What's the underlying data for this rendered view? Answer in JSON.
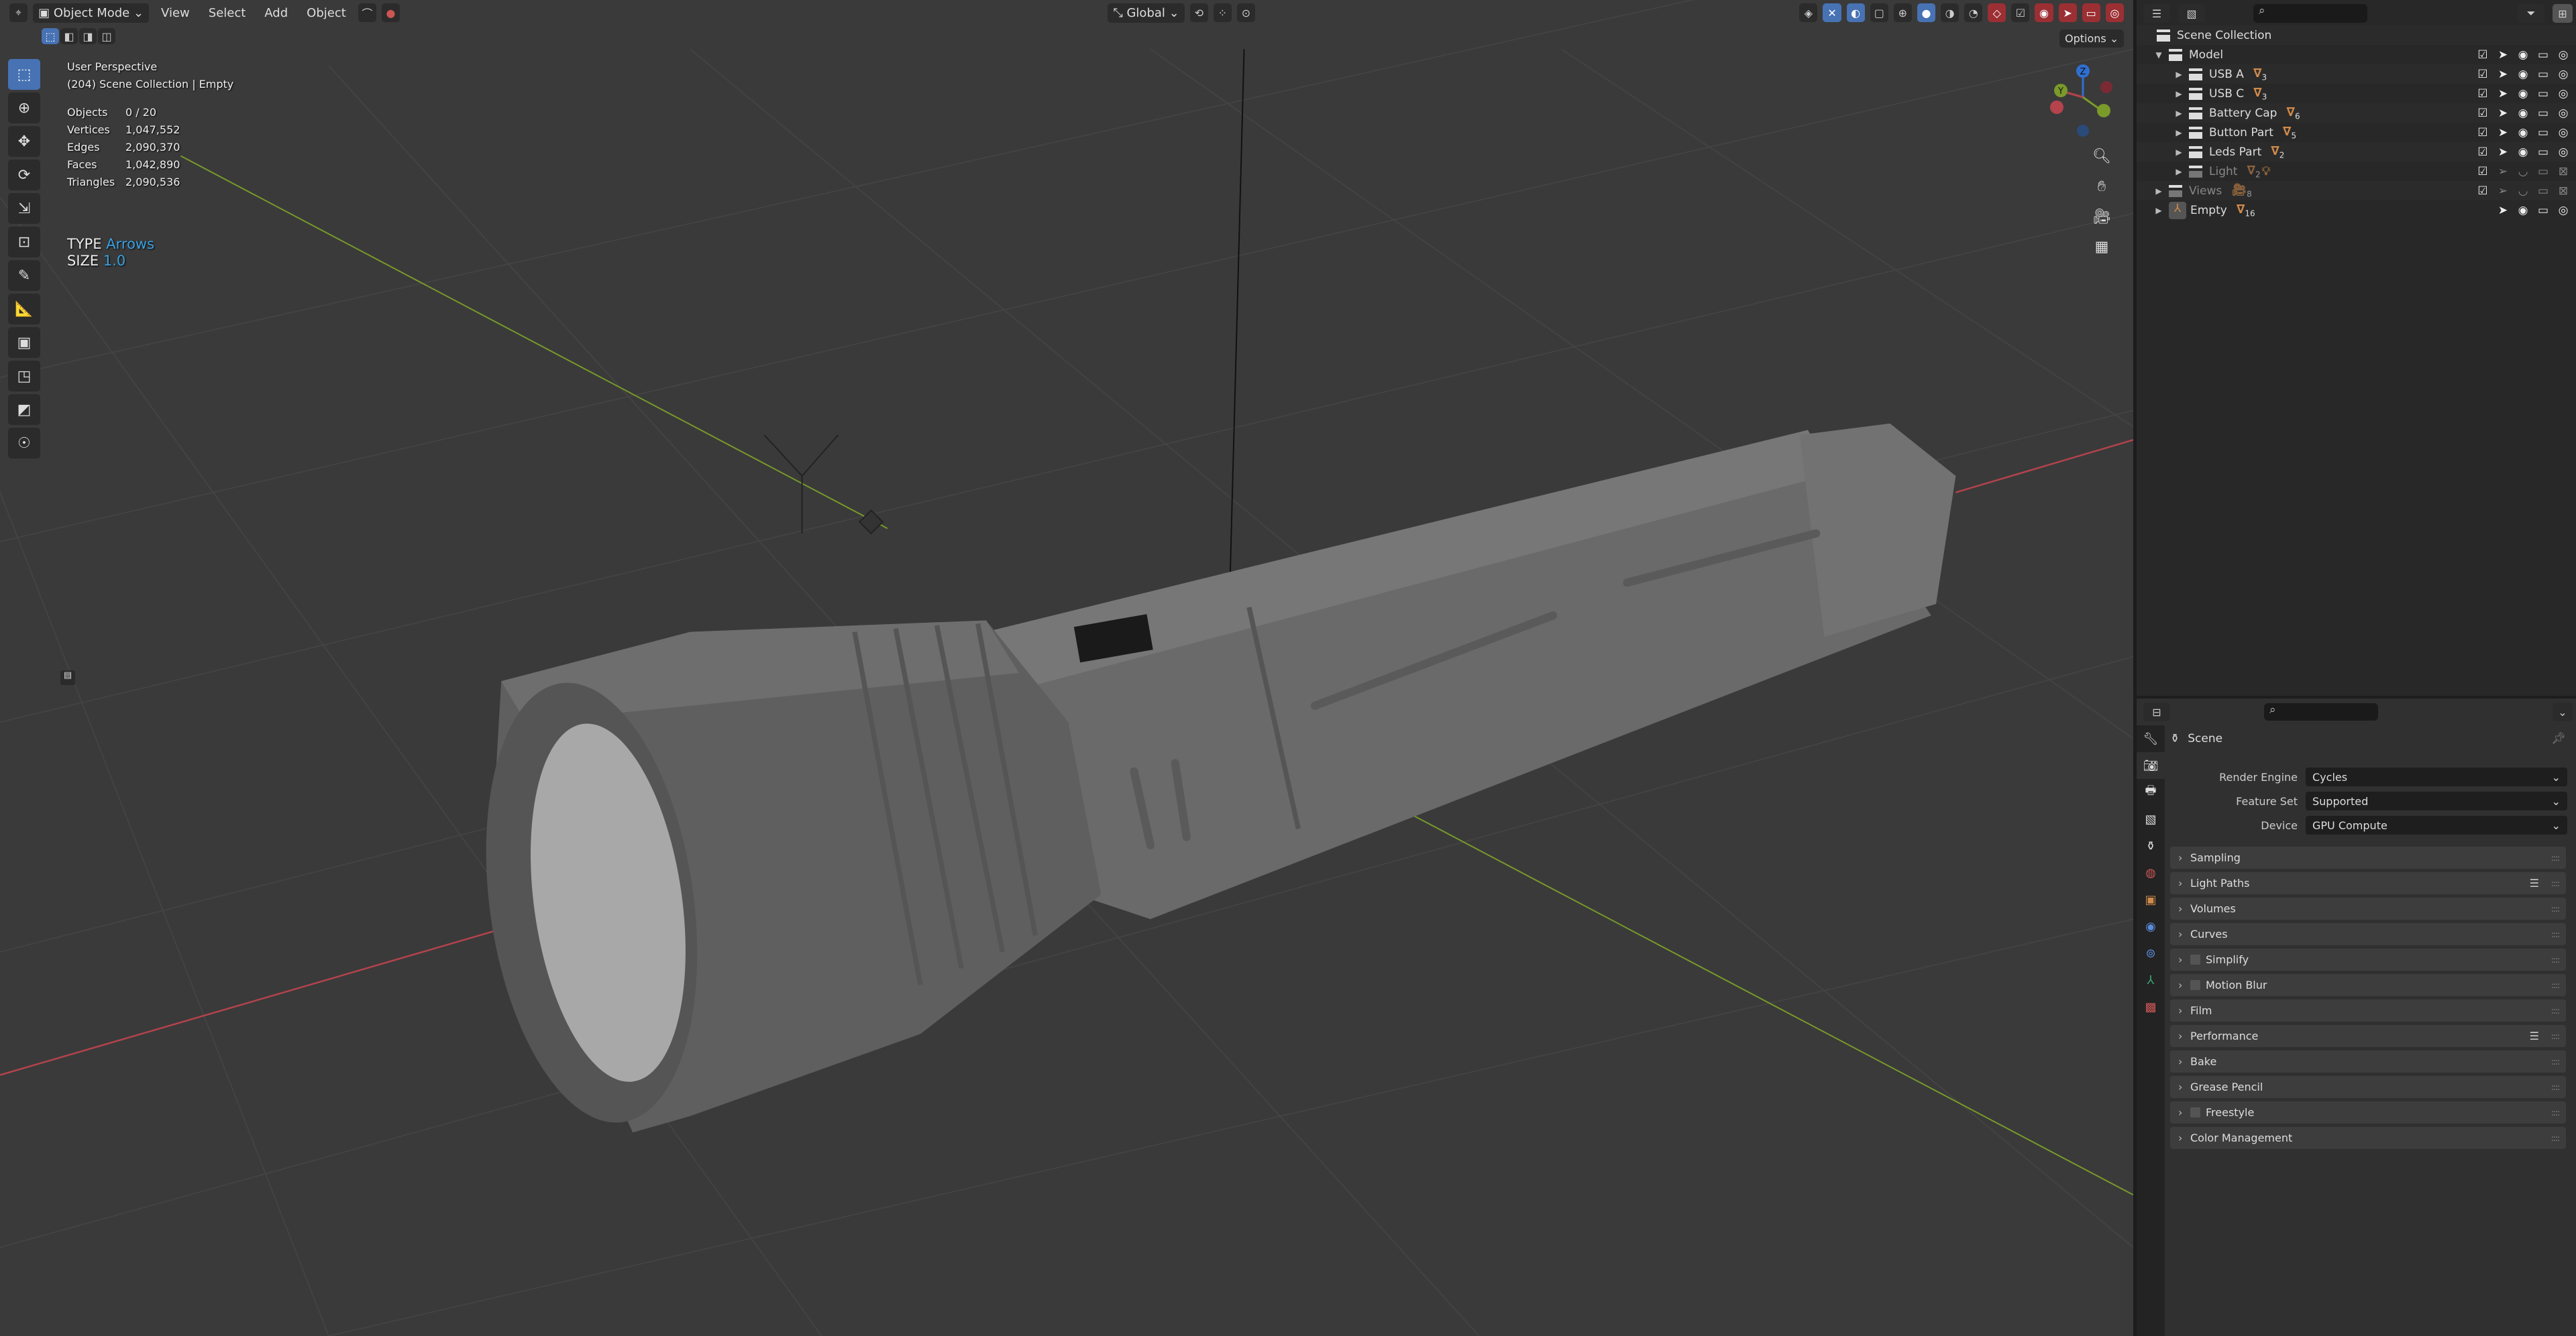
{
  "viewport": {
    "header": {
      "mode": "Object Mode",
      "menus": [
        "View",
        "Select",
        "Add",
        "Object"
      ],
      "orientation": "Global",
      "options": "Options"
    },
    "overlay": {
      "view_name": "User Perspective",
      "context": "(204) Scene Collection | Empty",
      "stats": [
        {
          "k": "Objects",
          "v": "0 / 20"
        },
        {
          "k": "Vertices",
          "v": "1,047,552"
        },
        {
          "k": "Edges",
          "v": "2,090,370"
        },
        {
          "k": "Faces",
          "v": "1,042,890"
        },
        {
          "k": "Triangles",
          "v": "2,090,536"
        }
      ],
      "type_label": "TYPE",
      "type_value": "Arrows",
      "size_label": "SIZE",
      "size_value": "1.0"
    },
    "gizmo": {
      "x": "X",
      "y": "Y",
      "z": "Z"
    }
  },
  "outliner": {
    "root": "Scene Collection",
    "rows": [
      {
        "name": "Model",
        "count": ""
      },
      {
        "name": "USB A",
        "count": "3"
      },
      {
        "name": "USB C",
        "count": "3"
      },
      {
        "name": "Battery Cap",
        "count": "6"
      },
      {
        "name": "Button Part",
        "count": "5"
      },
      {
        "name": "Leds Part",
        "count": "2"
      },
      {
        "name": "Light",
        "count": "2"
      },
      {
        "name": "Views",
        "count": "8"
      },
      {
        "name": "Empty",
        "count": "16"
      }
    ]
  },
  "properties": {
    "title": "Scene",
    "fields": [
      {
        "label": "Render Engine",
        "value": "Cycles"
      },
      {
        "label": "Feature Set",
        "value": "Supported"
      },
      {
        "label": "Device",
        "value": "GPU Compute"
      }
    ],
    "panels": [
      "Sampling",
      "Light Paths",
      "Volumes",
      "Curves",
      "Simplify",
      "Motion Blur",
      "Film",
      "Performance",
      "Bake",
      "Grease Pencil",
      "Freestyle",
      "Color Management"
    ]
  },
  "colors": {
    "accent": "#4772b3",
    "object_orange": "#d08a4a",
    "x_axis": "#b5434d",
    "y_axis": "#7a9a2a"
  }
}
